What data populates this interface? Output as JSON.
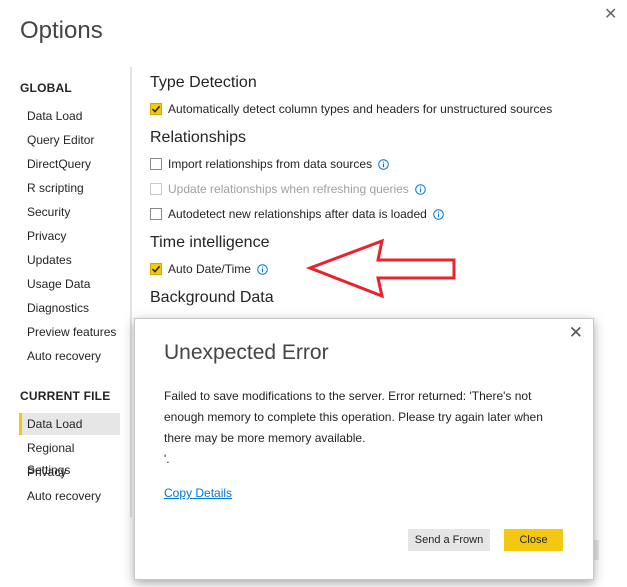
{
  "window": {
    "title": "Options",
    "close": "✕"
  },
  "sidebar": {
    "global_heading": "GLOBAL",
    "global_items": [
      "Data Load",
      "Query Editor",
      "DirectQuery",
      "R scripting",
      "Security",
      "Privacy",
      "Updates",
      "Usage Data",
      "Diagnostics",
      "Preview features",
      "Auto recovery"
    ],
    "file_heading": "CURRENT FILE",
    "file_items": [
      "Data Load",
      "Regional Settings",
      "Privacy",
      "Auto recovery"
    ],
    "active_item": "Data Load"
  },
  "content": {
    "type_detection": {
      "heading": "Type Detection",
      "auto_detect": {
        "label": "Automatically detect column types and headers for unstructured sources",
        "checked": true
      }
    },
    "relationships": {
      "heading": "Relationships",
      "import": {
        "label": "Import relationships from data sources",
        "checked": false
      },
      "update": {
        "label": "Update relationships when refreshing queries",
        "checked": false,
        "disabled": true
      },
      "autodetect": {
        "label": "Autodetect new relationships after data is loaded",
        "checked": false
      }
    },
    "time_intelligence": {
      "heading": "Time intelligence",
      "auto_date": {
        "label": "Auto Date/Time",
        "checked": true
      }
    },
    "background_data": {
      "heading": "Background Data"
    }
  },
  "annotation": {
    "arrow_color": "#e8232a"
  },
  "dialog": {
    "title": "Unexpected Error",
    "message": "Failed to save modifications to the server. Error returned: 'There's not enough memory to complete this operation. Please try again later when there may be more memory available.\n'.",
    "link": "Copy Details",
    "send_frown": "Send a Frown",
    "close": "Close",
    "close_icon": "✕"
  },
  "colors": {
    "accent": "#f2c811",
    "link": "#0078d4"
  }
}
